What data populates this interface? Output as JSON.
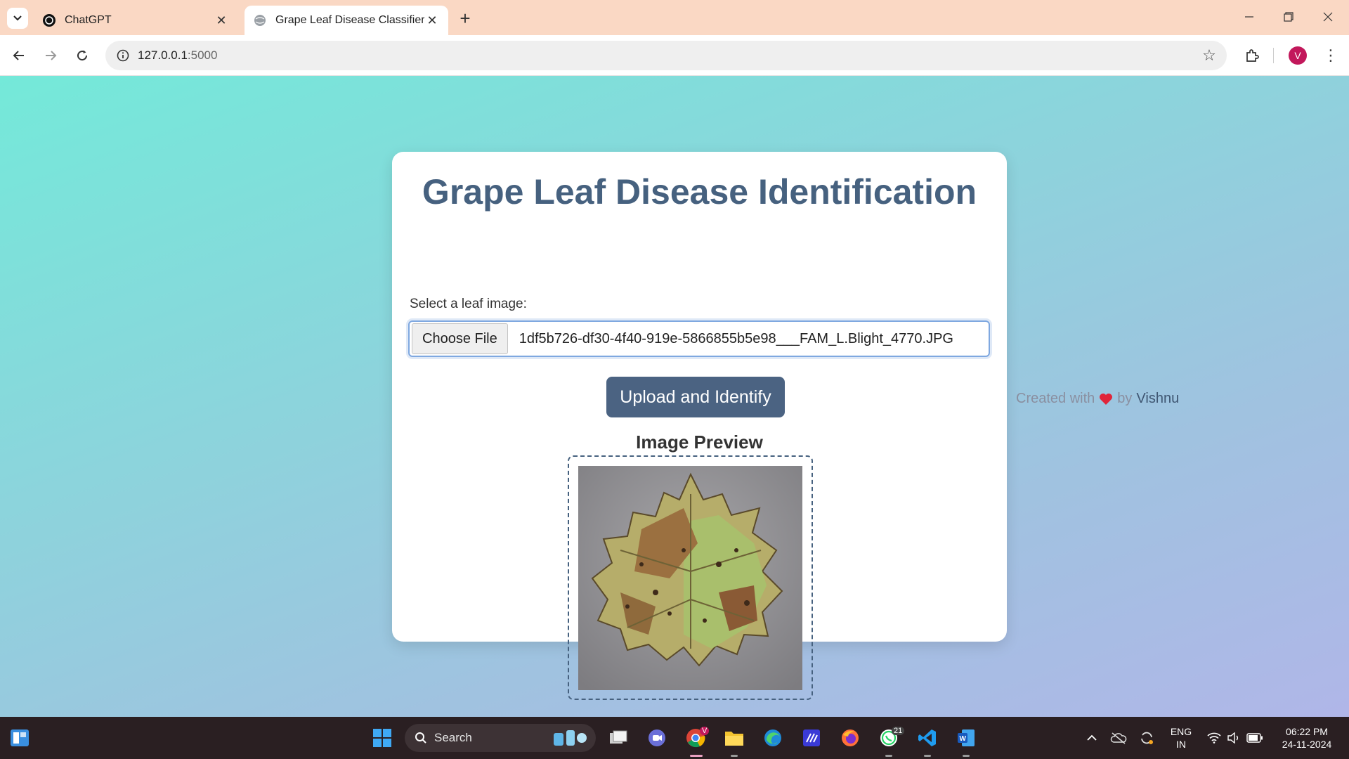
{
  "browser": {
    "tabs": [
      {
        "title": "ChatGPT",
        "active": false
      },
      {
        "title": "Grape Leaf Disease Classifier",
        "active": true
      }
    ],
    "url_host": "127.0.0.1",
    "url_port": ":5000",
    "profile_initial": "V"
  },
  "page": {
    "title": "Grape Leaf Disease Identification",
    "file_label": "Select a leaf image:",
    "choose_file_label": "Choose File",
    "selected_file": "1df5b726-df30-4f40-919e-5866855b5e98___FAM_L.Blight_4770.JPG",
    "upload_button": "Upload and Identify",
    "preview_heading": "Image Preview",
    "credit_prefix": "Created with",
    "credit_by": "by",
    "credit_name": "Vishnu"
  },
  "taskbar": {
    "search_label": "Search",
    "whatsapp_badge": "21",
    "chrome_badge": "V",
    "lang_line1": "ENG",
    "lang_line2": "IN",
    "time": "06:22 PM",
    "date": "24-11-2024"
  },
  "colors": {
    "title": "#46617f",
    "button": "#4b6382",
    "tabstrip": "#fad8c4",
    "taskbar": "#2a1f22"
  }
}
